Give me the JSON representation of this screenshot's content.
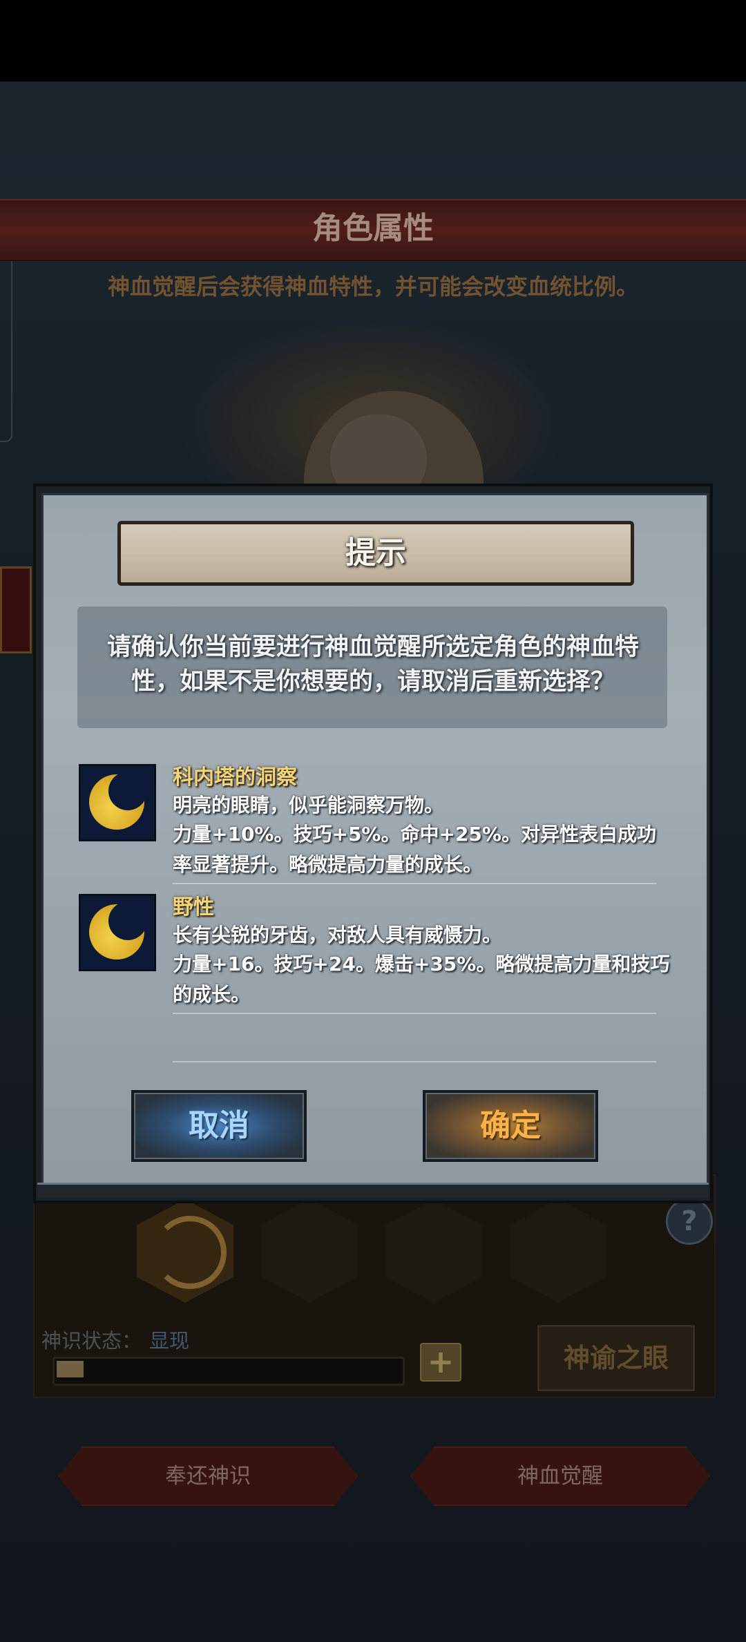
{
  "background": {
    "title": "角色属性",
    "subtitle": "神血觉醒后会获得神血特性，并可能会改变血统比例。",
    "divine_sense_label": "神识状态：",
    "divine_sense_value": "显现",
    "divine_sense_progress": 0.08,
    "oracle_eye_button": "神谕之眼",
    "return_button": "奉还神识",
    "awaken_button": "神血觉醒",
    "help_symbol": "?",
    "plus_symbol": "+"
  },
  "dialog": {
    "title": "提示",
    "message": "请确认你当前要进行神血觉醒所选定角色的神血特性，如果不是你想要的，请取消后重新选择？",
    "traits": [
      {
        "name": "科内塔的洞察",
        "line1": "明亮的眼睛，似乎能洞察万物。",
        "line2": "力量+10%。技巧+5%。命中+25%。对异性表白成功率显著提升。略微提高力量的成长。",
        "icon": "crescent-moon-icon"
      },
      {
        "name": "野性",
        "line1": "长有尖锐的牙齿，对敌人具有威慑力。",
        "line2": "力量+16。技巧+24。爆击+35%。略微提高力量和技巧的成长。",
        "icon": "crescent-moon-icon"
      }
    ],
    "cancel_label": "取消",
    "confirm_label": "确定"
  },
  "colors": {
    "trait_name": "#f3d57a",
    "cancel_glow": "#4d86c2",
    "confirm_glow": "#ffb14a",
    "title_bar": "#5a201b"
  }
}
